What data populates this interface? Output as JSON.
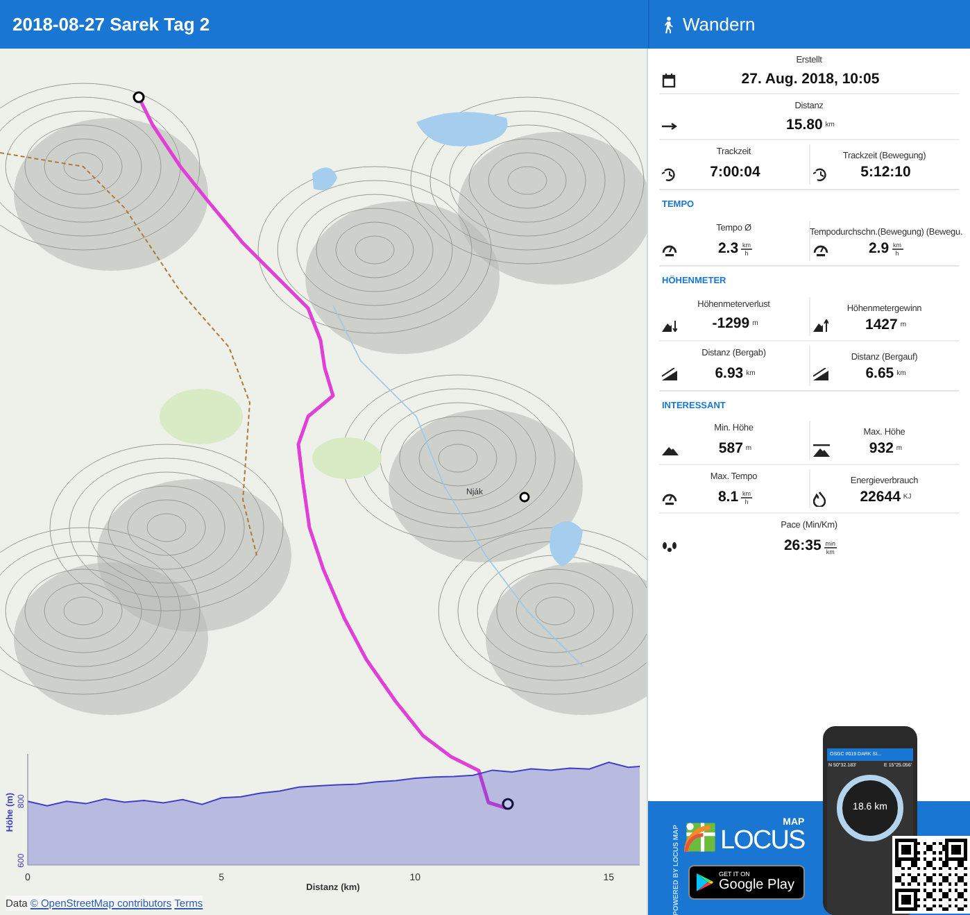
{
  "header": {
    "title": "2018-08-27 Sarek Tag 2",
    "activity": "Wandern"
  },
  "map": {
    "peak_label": "Nják",
    "attribution": {
      "prefix": "Data",
      "links": [
        "© OpenStreetMap contributors",
        "Terms"
      ]
    },
    "chart_data": {
      "type": "area",
      "xlabel": "Distanz (km)",
      "ylabel": "Höhe (m)",
      "x": [
        0,
        0.5,
        1,
        1.5,
        2,
        2.5,
        3,
        3.5,
        4,
        4.5,
        5,
        5.5,
        6,
        6.5,
        7,
        7.5,
        8,
        8.5,
        9,
        9.5,
        10,
        10.5,
        11,
        11.5,
        12,
        12.5,
        13,
        13.5,
        14,
        14.5,
        15,
        15.5,
        15.8
      ],
      "series": [
        {
          "color": "#3f3fc8",
          "values": [
            800,
            785,
            800,
            792,
            808,
            797,
            803,
            795,
            806,
            790,
            812,
            815,
            828,
            835,
            848,
            852,
            856,
            858,
            866,
            870,
            878,
            882,
            884,
            888,
            905,
            899,
            910,
            905,
            912,
            909,
            932,
            915,
            918
          ]
        }
      ],
      "xlim": [
        0,
        15.8
      ],
      "ylim": [
        585,
        960
      ],
      "xticks": [
        0,
        5,
        10,
        15
      ],
      "yticks": [
        600,
        800
      ]
    }
  },
  "stats": {
    "sections": [
      {
        "rows": [
          [
            {
              "kind": "date",
              "label": "Erstellt",
              "value": "27. Aug. 2018, 10:05"
            }
          ],
          [
            {
              "kind": "distance",
              "label": "Distanz",
              "value": "15.80",
              "unit": "km"
            }
          ],
          [
            {
              "kind": "time",
              "label": "Trackzeit",
              "value": "7:00:04"
            },
            {
              "kind": "time",
              "label": "Trackzeit (Bewegung)",
              "value": "5:12:10"
            }
          ]
        ]
      },
      {
        "title": "TEMPO",
        "rows": [
          [
            {
              "kind": "speed",
              "label": "Tempo Ø",
              "value": "2.3",
              "unit": "km",
              "unit_denominator": "h"
            },
            {
              "kind": "speed",
              "label": "Tempodurchschn.(Bewegung) (Bewegu.",
              "value": "2.9",
              "unit": "km",
              "unit_denominator": "h"
            }
          ]
        ]
      },
      {
        "title": "HÖHENMETER",
        "rows": [
          [
            {
              "kind": "descent",
              "label": "Höhenmeterverlust",
              "value": "-1299",
              "unit": "m"
            },
            {
              "kind": "ascent",
              "label": "Höhenmetergewinn",
              "value": "1427",
              "unit": "m"
            }
          ],
          [
            {
              "kind": "slope",
              "label": "Distanz (Bergab)",
              "value": "6.93",
              "unit": "km"
            },
            {
              "kind": "slope",
              "label": "Distanz (Bergauf)",
              "value": "6.65",
              "unit": "km"
            }
          ]
        ]
      },
      {
        "title": "INTERESSANT",
        "rows": [
          [
            {
              "kind": "min-alt",
              "label": "Min. Höhe",
              "value": "587",
              "unit": "m"
            },
            {
              "kind": "max-alt",
              "label": "Max. Höhe",
              "value": "932",
              "unit": "m"
            }
          ],
          [
            {
              "kind": "speed",
              "label": "Max. Tempo",
              "value": "8.1",
              "unit": "km",
              "unit_denominator": "h"
            },
            {
              "kind": "energy",
              "label": "Energieverbrauch",
              "value": "22644",
              "unit": "KJ"
            }
          ],
          [
            {
              "kind": "pace",
              "label": "Pace (Min/Km)",
              "value": "26:35",
              "unit": "min",
              "unit_denominator": "km"
            }
          ]
        ]
      }
    ]
  },
  "promo": {
    "powered_by": "POWERED BY LOCUS MAP",
    "logo_small": "MAP",
    "logo_big": "LOCUS",
    "store_line1": "GET IT ON",
    "store_line2": "Google Play",
    "phone": {
      "title": "OSGC #019 DARK SI...",
      "latitude": "N 50°32.183'",
      "longitude": "E 15°25.056'",
      "distance": "18.6 km"
    }
  }
}
